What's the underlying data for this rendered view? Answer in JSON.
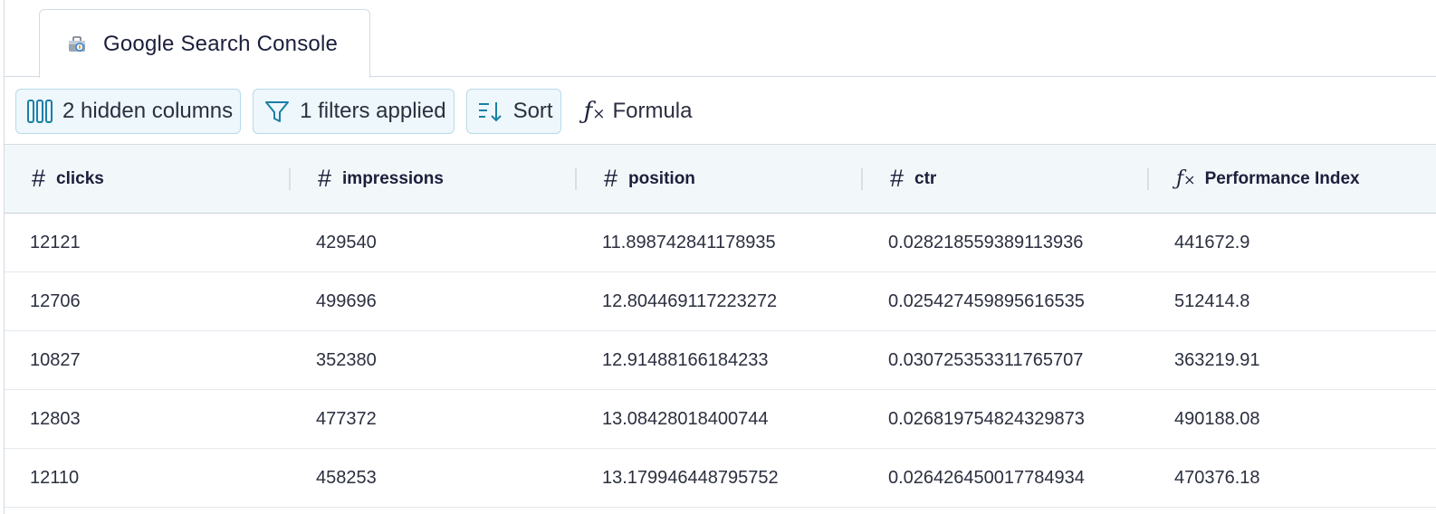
{
  "tab": {
    "label": "Google Search Console",
    "icon": "toolbox-icon"
  },
  "toolbar": {
    "hidden_columns": "2 hidden columns",
    "filters": "1 filters applied",
    "sort": "Sort",
    "formula": "Formula"
  },
  "columns": [
    {
      "type": "number",
      "label": "clicks"
    },
    {
      "type": "number",
      "label": "impressions"
    },
    {
      "type": "number",
      "label": "position"
    },
    {
      "type": "number",
      "label": "ctr"
    },
    {
      "type": "formula",
      "label": "Performance Index"
    }
  ],
  "rows": [
    [
      "12121",
      "429540",
      "11.898742841178935",
      "0.028218559389113936",
      "441672.9"
    ],
    [
      "12706",
      "499696",
      "12.804469117223272",
      "0.025427459895616535",
      "512414.8"
    ],
    [
      "10827",
      "352380",
      "12.91488166184233",
      "0.030725353311765707",
      "363219.91"
    ],
    [
      "12803",
      "477372",
      "13.08428018400744",
      "0.026819754824329873",
      "490188.08"
    ],
    [
      "12110",
      "458253",
      "13.179946448795752",
      "0.026426450017784934",
      "470376.18"
    ]
  ],
  "colors": {
    "accent": "#1a7fa6",
    "header_bg": "#f2f7f9",
    "button_bg": "#eef7fb"
  }
}
